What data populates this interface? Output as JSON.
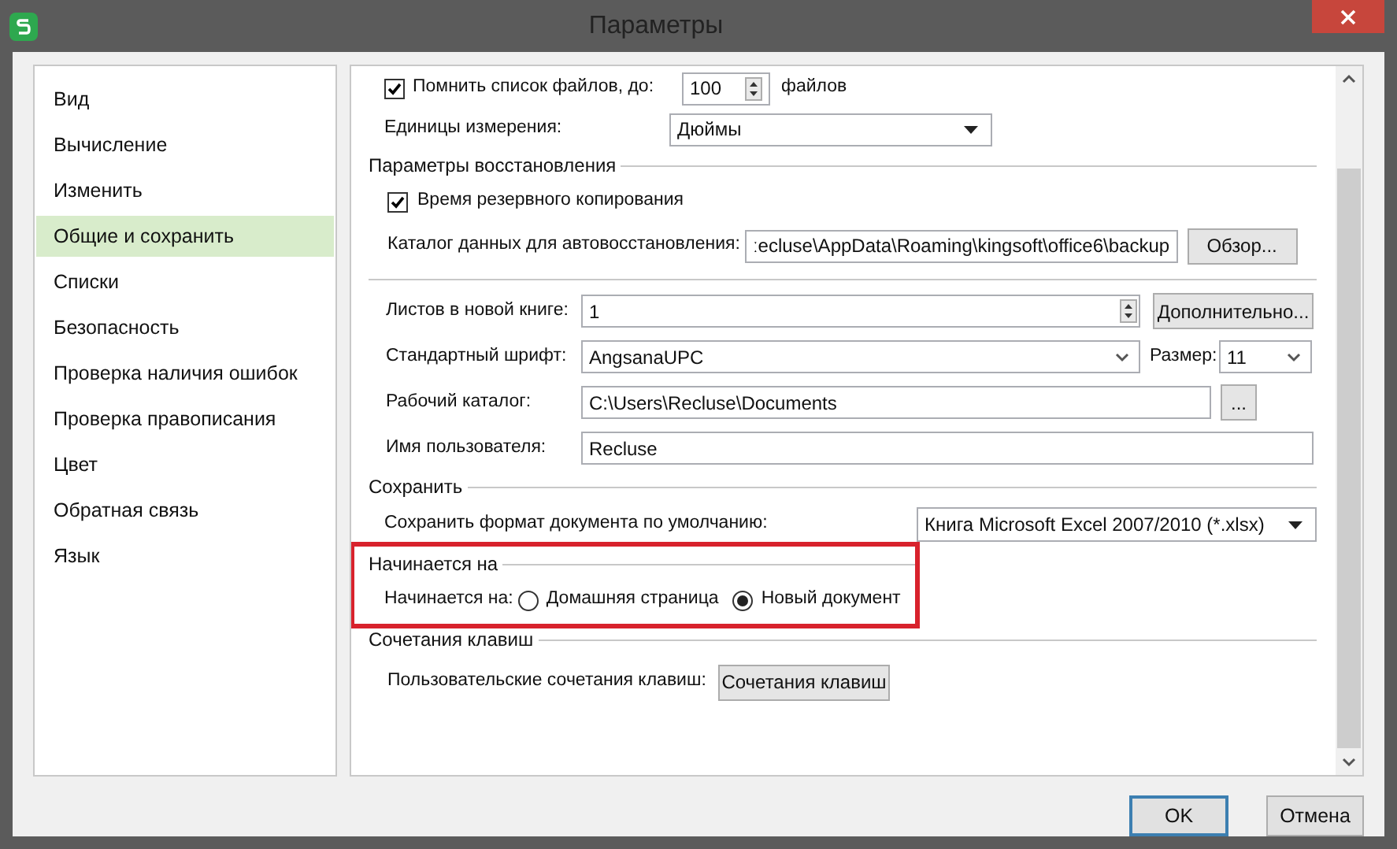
{
  "window": {
    "title": "Параметры"
  },
  "sidebar": {
    "items": [
      {
        "label": "Вид",
        "selected": false
      },
      {
        "label": "Вычисление",
        "selected": false
      },
      {
        "label": "Изменить",
        "selected": false
      },
      {
        "label": "Общие и сохранить",
        "selected": true
      },
      {
        "label": "Списки",
        "selected": false
      },
      {
        "label": "Безопасность",
        "selected": false
      },
      {
        "label": "Проверка наличия ошибок",
        "selected": false
      },
      {
        "label": "Проверка правописания",
        "selected": false
      },
      {
        "label": "Цвет",
        "selected": false
      },
      {
        "label": "Обратная связь",
        "selected": false
      },
      {
        "label": "Язык",
        "selected": false
      }
    ]
  },
  "groups": [
    {
      "highlighted": false,
      "rows": [
        {
          "kind": "checkbox_spin",
          "checked": true,
          "label": "Помнить список файлов, до:",
          "value": "100",
          "suffix": "файлов"
        },
        {
          "kind": "select",
          "label": "Единицы измерения:",
          "value": "Дюймы"
        }
      ]
    },
    {
      "title": "Параметры восстановления",
      "highlighted": false,
      "rows": [
        {
          "kind": "checkbox",
          "checked": true,
          "label": "Время резервного копирования"
        },
        {
          "kind": "path",
          "label": "Каталог данных для автовосстановления:",
          "value": "ːecluse\\AppData\\Roaming\\kingsoft\\office6\\backup",
          "button": "Обзор..."
        }
      ]
    },
    {
      "highlighted": false,
      "rows": [
        {
          "kind": "spin",
          "label": "Листов в новой книге:",
          "value": "1",
          "button": "Дополнительно..."
        },
        {
          "kind": "font",
          "label": "Стандартный шрифт:",
          "value": "AngsanaUPC",
          "size_label": "Размер:",
          "size_value": "11"
        },
        {
          "kind": "browse",
          "label": "Рабочий каталог:",
          "value": "C:\\Users\\Recluse\\Documents",
          "button": "..."
        },
        {
          "kind": "text",
          "label": "Имя пользователя:",
          "value": "Recluse"
        }
      ]
    },
    {
      "title": "Сохранить",
      "highlighted": false,
      "rows": [
        {
          "kind": "wide_select",
          "label": "Сохранить формат документа по умолчанию:",
          "value": "Книга Microsoft Excel 2007/2010 (*.xlsx)"
        }
      ]
    },
    {
      "title": "Начинается на",
      "highlighted": true,
      "rows": [
        {
          "kind": "radio",
          "label": "Начинается на:",
          "options": [
            {
              "label": "Домашняя страница",
              "selected": false
            },
            {
              "label": "Новый документ",
              "selected": true
            }
          ]
        }
      ]
    },
    {
      "title": "Сочетания клавиш",
      "highlighted": false,
      "rows": [
        {
          "kind": "button",
          "label": "Пользовательские сочетания клавиш:",
          "button": "Сочетания клавиш"
        }
      ]
    }
  ],
  "buttons": [
    {
      "label": "OK",
      "default": true
    },
    {
      "label": "Отмена",
      "default": false
    }
  ]
}
